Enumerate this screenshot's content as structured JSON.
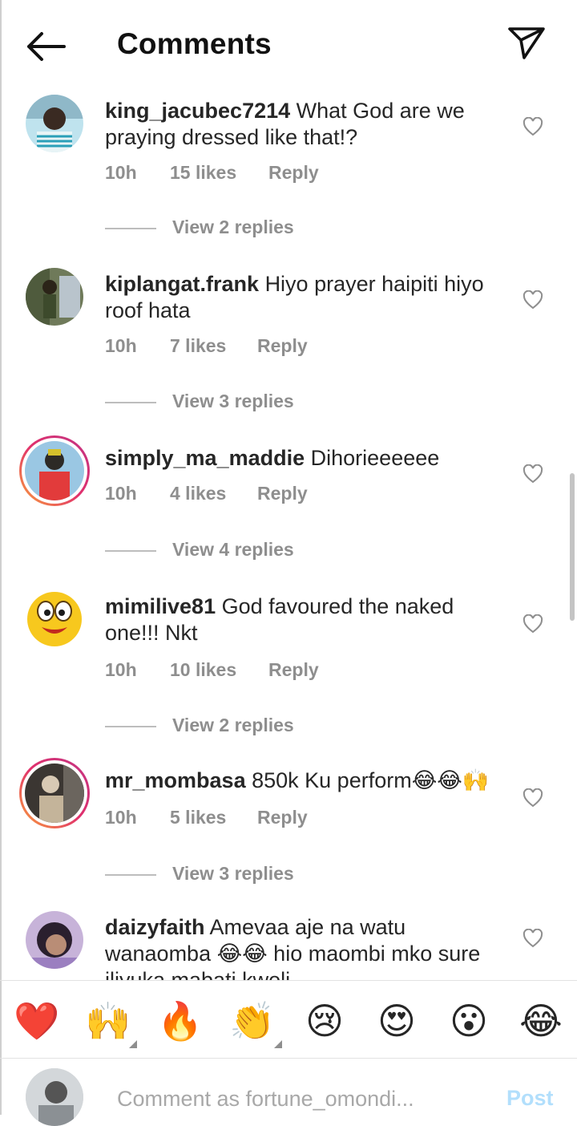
{
  "header": {
    "title": "Comments"
  },
  "comments": [
    {
      "username": "king_jacubec7214",
      "text": "What God are we praying dressed like that!?",
      "time": "10h",
      "likes": "15 likes",
      "reply": "Reply",
      "view_replies": "View 2 replies"
    },
    {
      "username": "kiplangat.frank",
      "text": "Hiyo prayer haipiti hiyo roof hata",
      "time": "10h",
      "likes": "7 likes",
      "reply": "Reply",
      "view_replies": "View 3 replies"
    },
    {
      "username": "simply_ma_maddie",
      "text": "Dihorieeeeee",
      "time": "10h",
      "likes": "4 likes",
      "reply": "Reply",
      "view_replies": "View 4 replies"
    },
    {
      "username": "mimilive81",
      "text": "God favoured the naked one!!! Nkt",
      "time": "10h",
      "likes": "10 likes",
      "reply": "Reply",
      "view_replies": "View 2 replies"
    },
    {
      "username": "mr_mombasa",
      "text": "850k Ku perform😂😂🙌",
      "time": "10h",
      "likes": "5 likes",
      "reply": "Reply",
      "view_replies": "View 3 replies"
    },
    {
      "username": "daizyfaith",
      "text": "Amevaa aje na watu wanaomba 😂😂 hio maombi mko sure iliyuka mabati kweli"
    }
  ],
  "emoji_reactions": [
    "❤️",
    "🙌",
    "🔥",
    "👏",
    "😢",
    "😍",
    "😮",
    "😂"
  ],
  "composer": {
    "placeholder": "Comment as fortune_omondi...",
    "post_label": "Post"
  },
  "colors": {
    "post_disabled": "#b2dffc",
    "meta_gray": "#8e8e8e",
    "story_ring": "#e1306c"
  }
}
